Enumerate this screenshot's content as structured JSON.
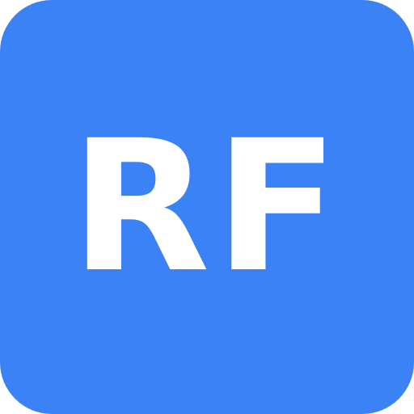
{
  "icon": {
    "label": "RF",
    "background_color": "#3b82f6",
    "text_color": "#ffffff"
  }
}
